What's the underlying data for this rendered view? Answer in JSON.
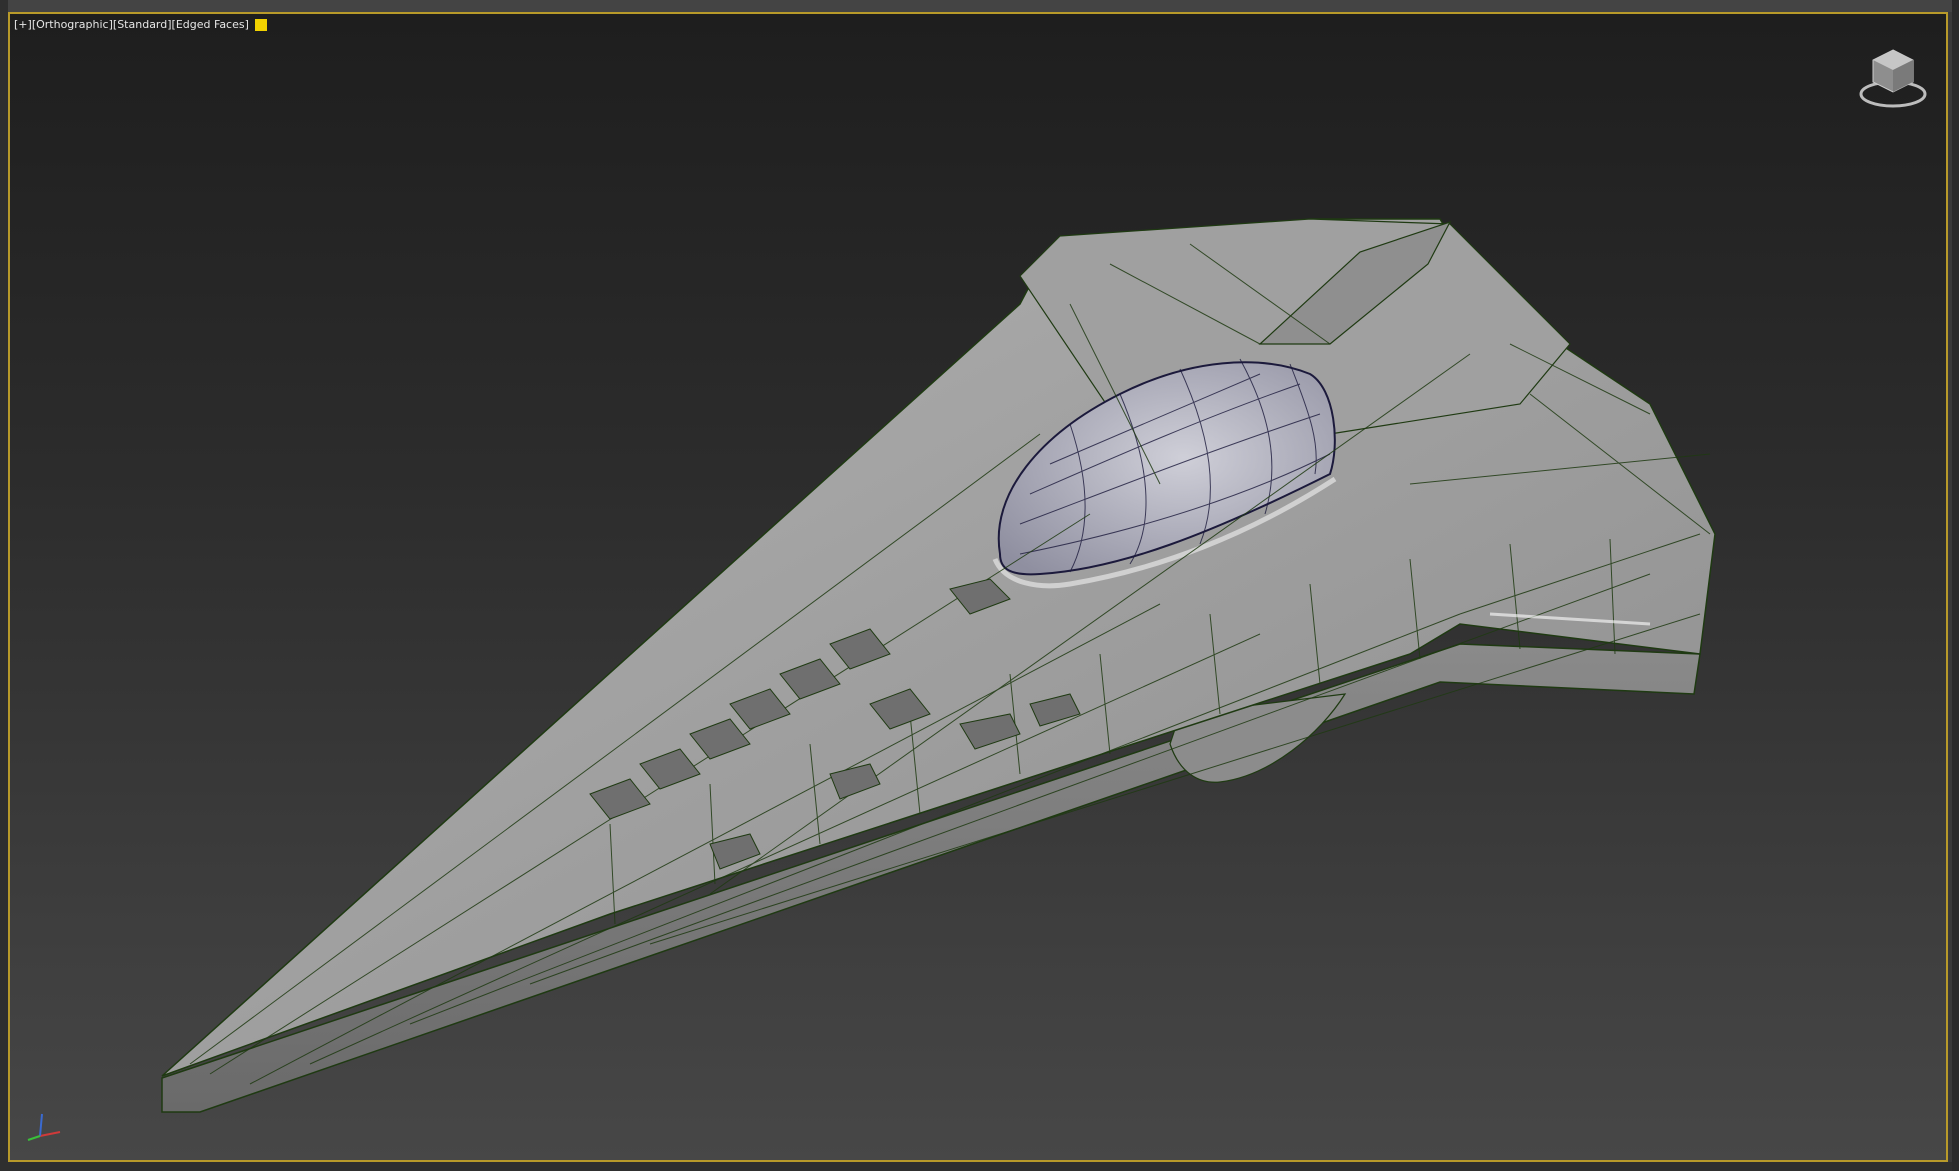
{
  "viewport": {
    "menu_plus": "[+]",
    "view_type": "[Orthographic]",
    "shading": "[Standard]",
    "display_mode": "[Edged Faces]",
    "swatch_color": "#f2d200",
    "border_color": "#b89a2a"
  },
  "icons": {
    "viewcube": "viewcube-icon",
    "axis": "axis-tripod-icon"
  },
  "colors": {
    "mesh_fill": "#9a9a9a",
    "mesh_edge": "#1f3a12",
    "canopy_fill": "#b4b4bf",
    "canopy_edge": "#1c1a3c"
  }
}
